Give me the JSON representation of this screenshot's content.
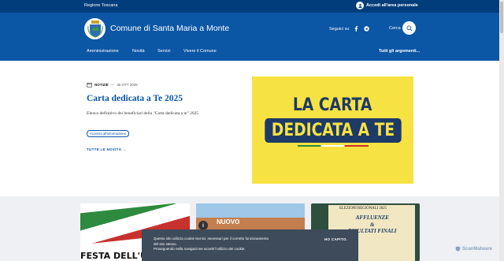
{
  "topbar": {
    "region": "Regione Toscana",
    "login": "Accedi all'area personale"
  },
  "header": {
    "site_name": "Comune di Santa Maria a Monte",
    "follow_label": "Seguici su",
    "search_label": "Cerca",
    "nav": [
      "Amministrazione",
      "Novità",
      "Servizi",
      "Vivere il Comune"
    ],
    "all_topics": "Tutti gli argomenti..."
  },
  "news": {
    "category": "NOTIZIE",
    "date": "30 OTT 2025",
    "title": "Carta dedicata a Te 2025",
    "description": "Elenco definitivo dei beneficiari della \"Carta dedicata a te\" 2025",
    "badge": "Accesso all'informazione",
    "all_news": "TUTTE LE NOVITÀ"
  },
  "promo": {
    "line1": "LA CARTA",
    "line2": "DEDICATA A TE"
  },
  "cards": {
    "card1_text": "FESTA DELL'UNITÀ",
    "card2_text": "NUOVO",
    "card3_header": "ELEZIONI REGIONALI 2025",
    "card3_line1": "AFFLUENZE",
    "card3_line2": "&",
    "card3_line3": "RISULTATI FINALI"
  },
  "cookie": {
    "line1": "Questo sito utilizza cookie tecnici, necessari per il corretto funzionamento del sito stesso.",
    "line2": "Proseguendo nella navigazione accetti l'utilizzo dei cookie.",
    "ok": "HO CAPITO."
  },
  "watermark": "ScanMalware",
  "colors": {
    "header_blue": "#0b56a5",
    "topbar_blue": "#003d7a",
    "promo_yellow": "#f6e243",
    "cookie_bg": "#3e4b5b"
  }
}
